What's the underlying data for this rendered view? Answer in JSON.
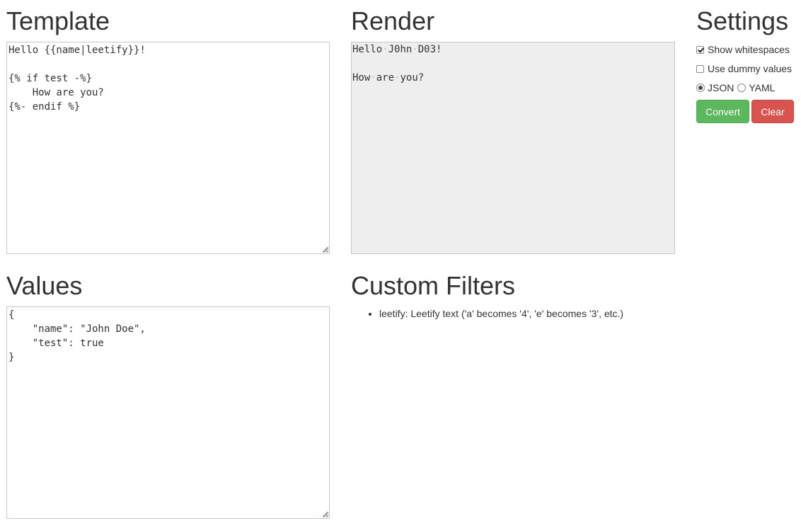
{
  "template": {
    "heading": "Template",
    "lines": [
      "Hello {{name|leetify}}!",
      "",
      "{% if test -%}",
      "    How are you?",
      "{%- endif %}"
    ]
  },
  "render": {
    "heading": "Render",
    "lines": [
      [
        "Hello",
        "J0hn",
        "D03!"
      ],
      [],
      [
        "How",
        "are",
        "you?"
      ]
    ]
  },
  "settings": {
    "heading": "Settings",
    "show_whitespaces": {
      "label": "Show whitespaces",
      "checked": true
    },
    "use_dummy_values": {
      "label": "Use dummy values",
      "checked": false
    },
    "format_options": [
      {
        "label": "JSON",
        "selected": true
      },
      {
        "label": "YAML",
        "selected": false
      }
    ],
    "convert_label": "Convert",
    "clear_label": "Clear",
    "convert_color": "#5cb85c",
    "clear_color": "#d9534f"
  },
  "values": {
    "heading": "Values",
    "lines": [
      "{",
      "    \"name\": \"John Doe\",",
      "    \"test\": true",
      "}"
    ]
  },
  "custom_filters": {
    "heading": "Custom Filters",
    "items": [
      "leetify: Leetify text ('a' becomes '4', 'e' becomes '3', etc.)"
    ]
  }
}
